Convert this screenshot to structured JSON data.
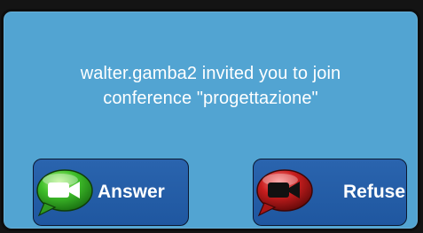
{
  "dialog": {
    "message_line1": "walter.gamba2 invited you to join",
    "message_line2": "conference \"progettazione\""
  },
  "buttons": {
    "answer": {
      "label": "Answer",
      "icon": "video-call-answer-icon",
      "color": "#3fbf2a"
    },
    "refuse": {
      "label": "Refuse",
      "icon": "video-call-refuse-icon",
      "color": "#c81e1e"
    }
  },
  "colors": {
    "dialog_background": "#52a4d2",
    "button_background": "#2a64ae",
    "text": "#ffffff"
  }
}
